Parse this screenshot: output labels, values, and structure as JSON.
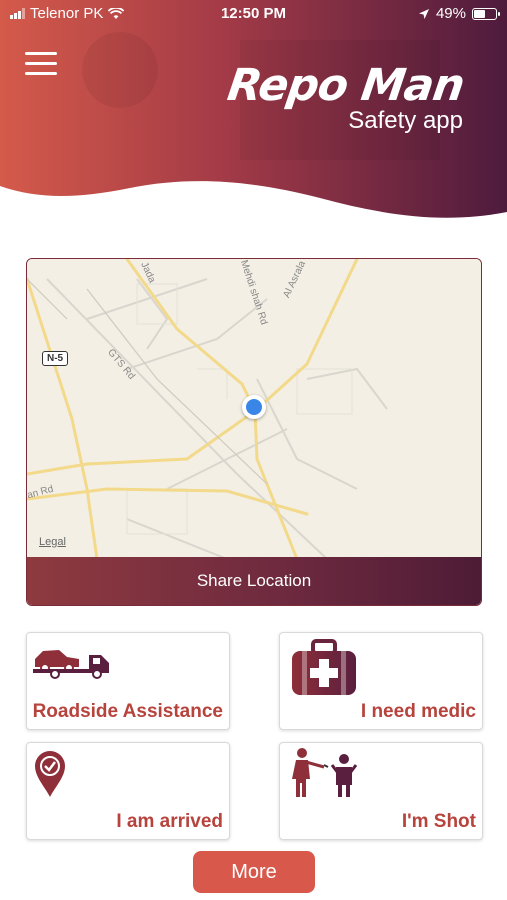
{
  "status_bar": {
    "carrier": "Telenor PK",
    "time": "12:50 PM",
    "battery": "49%"
  },
  "brand": {
    "title": "Repo Man",
    "subtitle": "Safety app"
  },
  "map": {
    "roads": [
      "Jada",
      "Mehdi shah Rd",
      "Al Asrala",
      "GTS Rd",
      "an Rd"
    ],
    "highway_shield": "N-5",
    "legal": "Legal",
    "share_label": "Share Location"
  },
  "actions": [
    {
      "label": "Roadside Assistance",
      "icon": "tow-truck-icon"
    },
    {
      "label": "I need medic",
      "icon": "first-aid-kit-icon"
    },
    {
      "label": "I am arrived",
      "icon": "location-check-icon"
    },
    {
      "label": "I'm Shot",
      "icon": "shooter-victim-icon"
    }
  ],
  "more_label": "More",
  "colors": {
    "brand_dark": "#5a1f3e",
    "brand_light": "#d45a4a",
    "accent_text": "#b7433d",
    "button": "#d8584c"
  }
}
